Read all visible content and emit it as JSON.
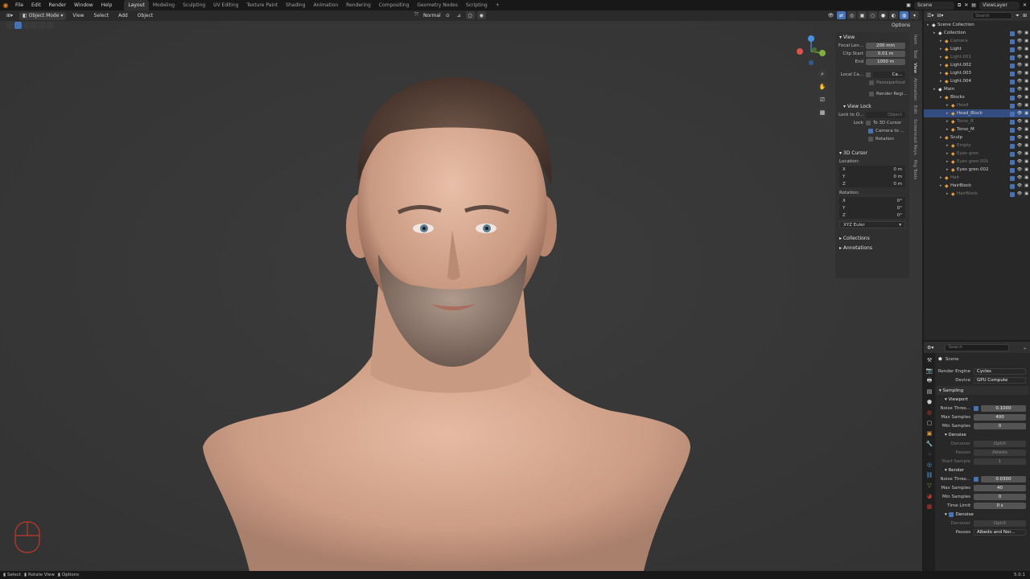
{
  "menubar": {
    "items": [
      "File",
      "Edit",
      "Render",
      "Window",
      "Help"
    ],
    "workspaces": [
      "Layout",
      "Modeling",
      "Sculpting",
      "UV Editing",
      "Texture Paint",
      "Shading",
      "Animation",
      "Rendering",
      "Compositing",
      "Geometry Nodes",
      "Scripting"
    ],
    "active_workspace": "Layout",
    "add_tab": "+",
    "scene": "Scene",
    "view_layer": "ViewLayer"
  },
  "viewport_header": {
    "mode": "Object Mode",
    "menus": [
      "View",
      "Select",
      "Add",
      "Object"
    ],
    "orientation": "Normal",
    "options": "Options"
  },
  "npanel": {
    "view_section": "View",
    "focal_length_label": "Focal Len...",
    "focal_length": "200 mm",
    "clip_start_label": "Clip Start",
    "clip_start": "0.01 m",
    "clip_end_label": "End",
    "clip_end": "1000 m",
    "local_camera_label": "Local Ca...",
    "local_camera_value": "Ca...",
    "passepartout": "Passepartout",
    "render_region": "Render Regi...",
    "view_lock_section": "View Lock",
    "lock_to_object_label": "Lock to O...",
    "lock_to_object_value": "Object",
    "lock_label": "Lock",
    "to_3d_cursor": "To 3D Cursor",
    "camera_to_view": "Camera to ...",
    "rotation": "Rotation",
    "cursor_section": "3D Cursor",
    "location_label": "Location:",
    "loc_x_label": "X",
    "loc_x": "0 m",
    "loc_y_label": "Y",
    "loc_y": "0 m",
    "loc_z_label": "Z",
    "loc_z": "0 m",
    "rotation_label": "Rotation:",
    "rot_x_label": "X",
    "rot_x": "0°",
    "rot_y_label": "Y",
    "rot_y": "0°",
    "rot_z_label": "Z",
    "rot_z": "0°",
    "rotation_mode": "XYZ Euler",
    "collections_section": "Collections",
    "annotations_section": "Annotations",
    "tabs": [
      "Item",
      "Tool",
      "View",
      "Animation",
      "Edit",
      "Screencast Keys",
      "Rig Tools"
    ],
    "active_tab": "View"
  },
  "outliner": {
    "search_placeholder": "Search",
    "rows": [
      {
        "name": "Scene Collection",
        "indent": 0,
        "dim": false
      },
      {
        "name": "Collection",
        "indent": 1,
        "dim": false
      },
      {
        "name": "Camera",
        "indent": 2,
        "dim": true
      },
      {
        "name": "Light",
        "indent": 2,
        "dim": false
      },
      {
        "name": "Light.001",
        "indent": 2,
        "dim": true
      },
      {
        "name": "Light.002",
        "indent": 2,
        "dim": false
      },
      {
        "name": "Light.003",
        "indent": 2,
        "dim": false
      },
      {
        "name": "Light.004",
        "indent": 2,
        "dim": false
      },
      {
        "name": "Main",
        "indent": 1,
        "dim": false
      },
      {
        "name": "Blocks",
        "indent": 2,
        "dim": false
      },
      {
        "name": "Head",
        "indent": 3,
        "dim": true
      },
      {
        "name": "Head_Block",
        "indent": 3,
        "dim": false,
        "selected": true
      },
      {
        "name": "Torso_B",
        "indent": 3,
        "dim": true
      },
      {
        "name": "Torso_M",
        "indent": 3,
        "dim": false
      },
      {
        "name": "Sculp",
        "indent": 2,
        "dim": false
      },
      {
        "name": "Empty",
        "indent": 3,
        "dim": true
      },
      {
        "name": "Eyes gren",
        "indent": 3,
        "dim": true
      },
      {
        "name": "Eyes gren.001",
        "indent": 3,
        "dim": true
      },
      {
        "name": "Eyes gren.002",
        "indent": 3,
        "dim": false
      },
      {
        "name": "Hair",
        "indent": 2,
        "dim": true
      },
      {
        "name": "HairBlock",
        "indent": 2,
        "dim": false
      },
      {
        "name": "HairBlock",
        "indent": 3,
        "dim": true
      }
    ]
  },
  "properties": {
    "search_placeholder": "Search",
    "scene_label": "Scene",
    "render_engine_label": "Render Engine",
    "render_engine": "Cycles",
    "device_label": "Device",
    "device": "GPU Compute",
    "sampling_section": "Sampling",
    "viewport_sub": "Viewport",
    "vp_noise_label": "Noise Thres...",
    "vp_noise": "0.1000",
    "vp_max_label": "Max Samples",
    "vp_max": "400",
    "vp_min_label": "Min Samples",
    "vp_min": "0",
    "denoise_sub": "Denoise",
    "denoiser_label": "Denoiser",
    "denoiser": "OptiX",
    "passes_label": "Passes",
    "passes": "Albedo",
    "start_sample_label": "Start Sample",
    "start_sample": "1",
    "render_sub": "Render",
    "r_noise_label": "Noise Thres...",
    "r_noise": "0.0300",
    "r_max_label": "Max Samples",
    "r_max": "40",
    "r_min_label": "Min Samples",
    "r_min": "0",
    "time_limit_label": "Time Limit",
    "time_limit": "0 s",
    "r_denoise_sub": "Denoise",
    "r_denoiser_label": "Denoiser",
    "r_denoiser": "OptiX",
    "r_passes_label": "Passes",
    "r_passes": "Albedo and Nor..."
  },
  "statusbar": {
    "select": "Select",
    "rotate_view": "Rotate View",
    "options": "Options",
    "version": "5.0.1"
  },
  "colors": {
    "accent": "#4772b3",
    "viewport_bg": "#3a3a3a",
    "skin": "#d3a58c"
  }
}
